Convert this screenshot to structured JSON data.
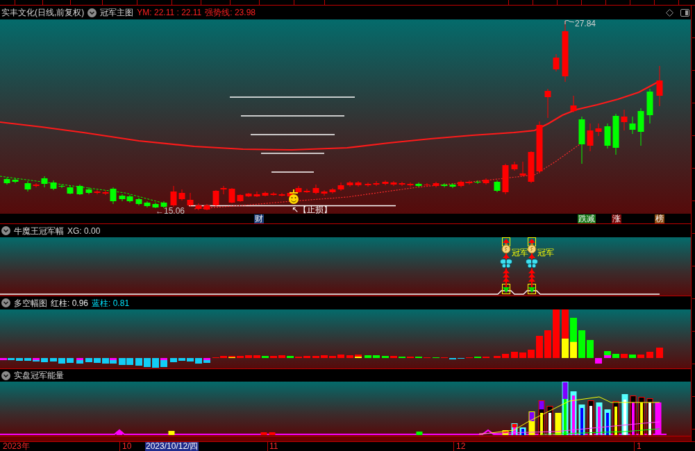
{
  "main_chart": {
    "security": "实丰文化(日线,前复权)",
    "indicator": "冠军主图",
    "readings": [
      "YM: 22.11 : 22.11",
      "强势线: 23.98"
    ],
    "high_label": "27.84",
    "low_label": "←15.06",
    "stop_loss_label": "↖【止损】",
    "markers": [
      {
        "text": "财",
        "color": "#1c3c78"
      },
      {
        "text": "跌减",
        "color": "#1a7a1a"
      },
      {
        "text": "涨",
        "color": "#7a0a0a"
      },
      {
        "text": "榜",
        "color": "#8a4a12"
      }
    ]
  },
  "signal_panel": {
    "indicator": "牛魔王冠军幅",
    "reading": "XG: 0.00",
    "signals": [
      {
        "label": "冠军"
      },
      {
        "label": "冠军"
      }
    ]
  },
  "bull_bear_panel": {
    "indicator": "多空幅图",
    "readings": [
      {
        "text": "红柱: 0.96",
        "color": "#e8e8e8"
      },
      {
        "text": "蓝柱: 0.81",
        "color": "#00e5ff"
      }
    ]
  },
  "energy_panel": {
    "indicator": "实盘冠军能量"
  },
  "time_axis": [
    {
      "text": "2023年",
      "kind": "tick"
    },
    {
      "text": "10",
      "kind": "tick"
    },
    {
      "text": "2023/10/12/四",
      "kind": "cursor"
    },
    {
      "text": "11",
      "kind": "tick"
    },
    {
      "text": "12",
      "kind": "tick"
    },
    {
      "text": "1",
      "kind": "tick"
    }
  ]
}
